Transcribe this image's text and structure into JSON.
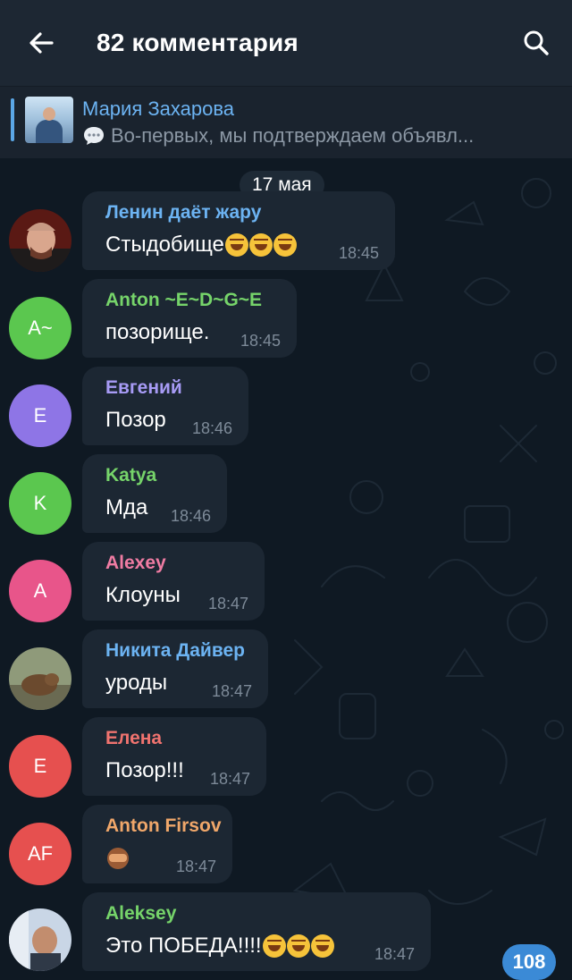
{
  "header": {
    "title": "82 комментария"
  },
  "pinned": {
    "author": "Мария Захарова",
    "preview": "Во-первых, мы подтверждаем объявл..."
  },
  "date_separator": "17 мая",
  "messages": [
    {
      "name": "Ленин даёт жару",
      "text": "Стыдобище",
      "emoji": [
        "rofl",
        "rofl",
        "rofl"
      ],
      "time": "18:45",
      "name_color": "#6cb3f2",
      "avatar": {
        "type": "photo"
      }
    },
    {
      "name": "Anton ~E~D~G~E",
      "text": "позорище.",
      "time": "18:45",
      "name_color": "#76d46a",
      "avatar": {
        "type": "initials",
        "initials": "A~",
        "color": "#5bc74f"
      }
    },
    {
      "name": "Евгений",
      "text": "Позор",
      "time": "18:46",
      "name_color": "#a79bf5",
      "avatar": {
        "type": "initials",
        "initials": "E",
        "color": "#8e75e6"
      }
    },
    {
      "name": "Katya",
      "text": "Мда",
      "time": "18:46",
      "name_color": "#76d46a",
      "avatar": {
        "type": "initials",
        "initials": "K",
        "color": "#5bc74f"
      }
    },
    {
      "name": "Alexey",
      "text": "Клоуны",
      "time": "18:47",
      "name_color": "#f07ca3",
      "avatar": {
        "type": "initials",
        "initials": "A",
        "color": "#e8558a"
      }
    },
    {
      "name": "Никита Дайвер",
      "text": "уроды",
      "time": "18:47",
      "name_color": "#6cb3f2",
      "avatar": {
        "type": "photo"
      }
    },
    {
      "name": "Елена",
      "text": "Позор!!!",
      "time": "18:47",
      "name_color": "#f0736f",
      "avatar": {
        "type": "initials",
        "initials": "E",
        "color": "#e6504f"
      }
    },
    {
      "name": "Anton Firsov",
      "text": "",
      "emoji": [
        "see-no-evil-monkey"
      ],
      "time": "18:47",
      "name_color": "#f0a76a",
      "avatar": {
        "type": "initials",
        "initials": "AF",
        "color": "#e6504f"
      }
    },
    {
      "name": "Aleksey",
      "text": "Это ПОБЕДА!!!!",
      "emoji": [
        "joy",
        "joy",
        "joy"
      ],
      "time": "18:47",
      "name_color": "#76d46a",
      "avatar": {
        "type": "photo"
      }
    }
  ],
  "unread_badge": "108",
  "icons": {
    "back": "arrow-left-icon",
    "search": "search-icon",
    "pinned_preview": "speech-bubble-icon"
  },
  "colors": {
    "background": "#0f1923",
    "header": "#1d2733",
    "bubble": "#1c2733",
    "accent": "#3b8ad6"
  }
}
